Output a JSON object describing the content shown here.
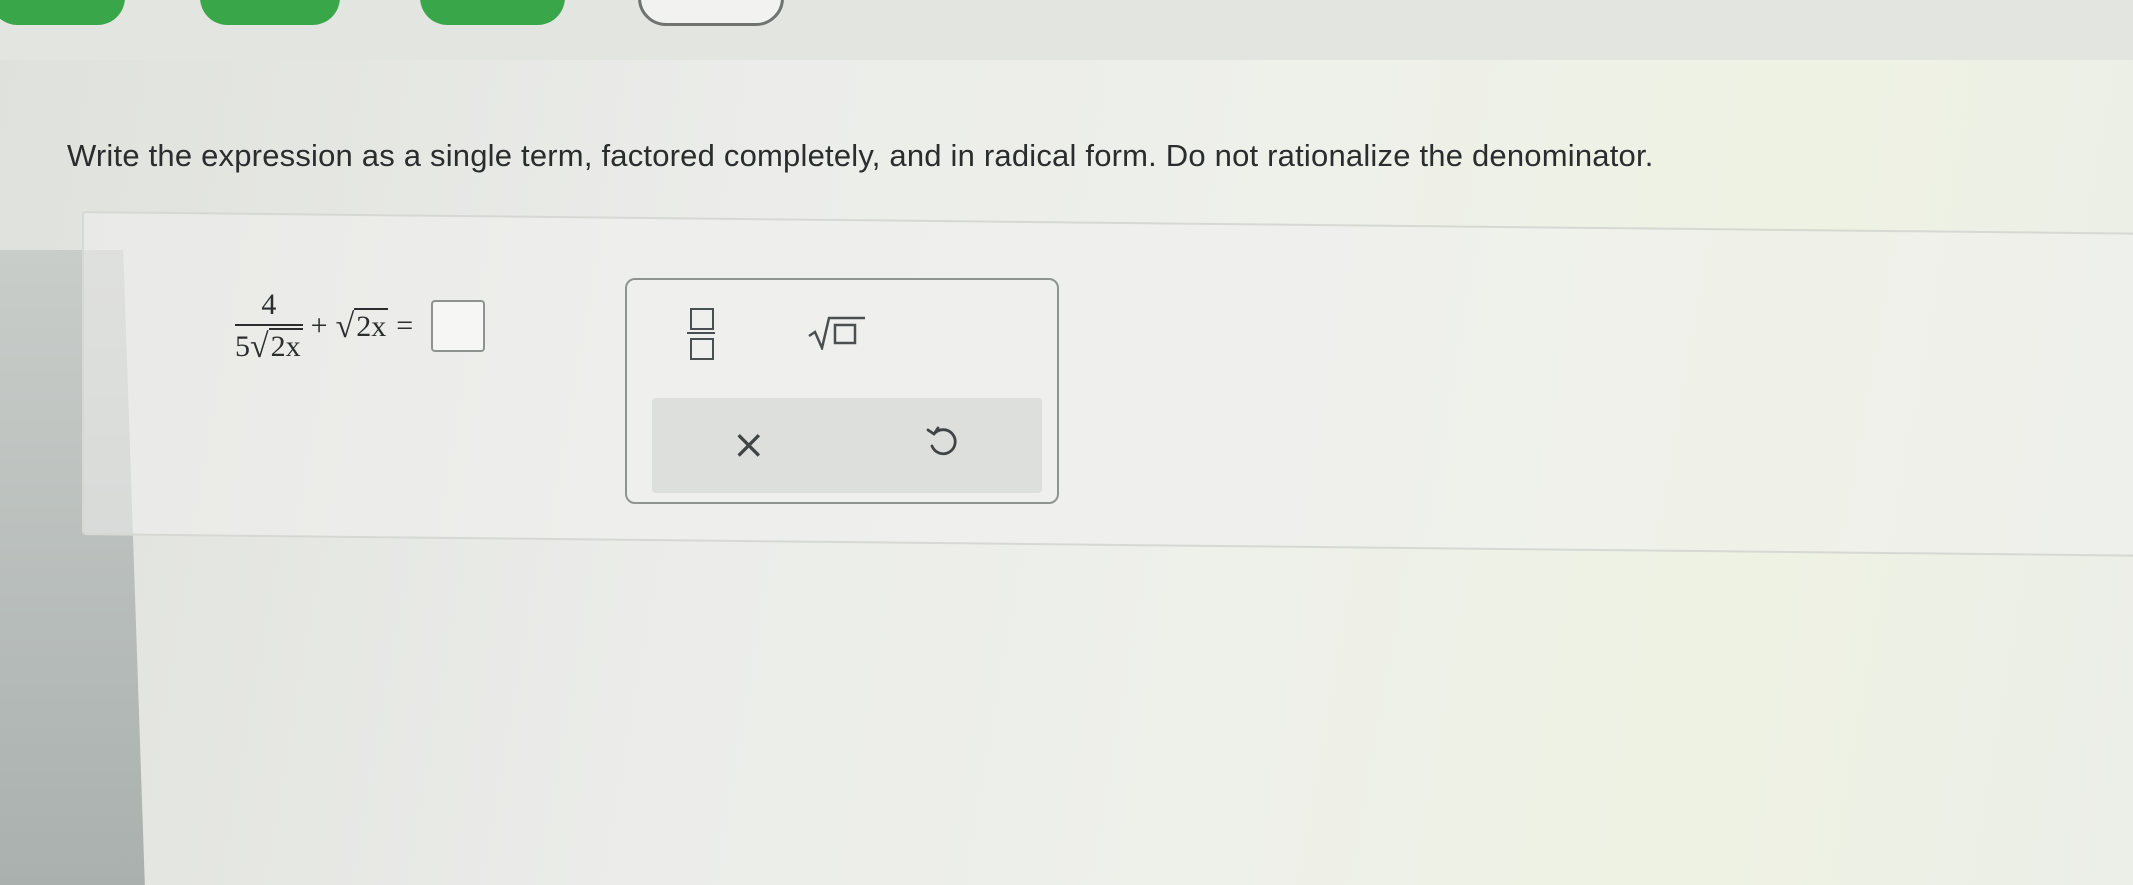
{
  "instruction": "Write the expression as a single term, factored completely, and in radical form. Do not rationalize the denominator.",
  "expression": {
    "fraction_numerator": "4",
    "fraction_denominator_coef": "5",
    "fraction_denominator_radicand": "2x",
    "plus": "+",
    "radicand": "2x",
    "equals": "="
  },
  "toolbox": {
    "fraction_tool": "fraction-icon",
    "sqrt_tool": "square-root-icon",
    "clear_icon": "×",
    "undo_tool": "undo-icon"
  },
  "colors": {
    "tab_green": "#3aa64a",
    "text": "#2a2c2d"
  }
}
